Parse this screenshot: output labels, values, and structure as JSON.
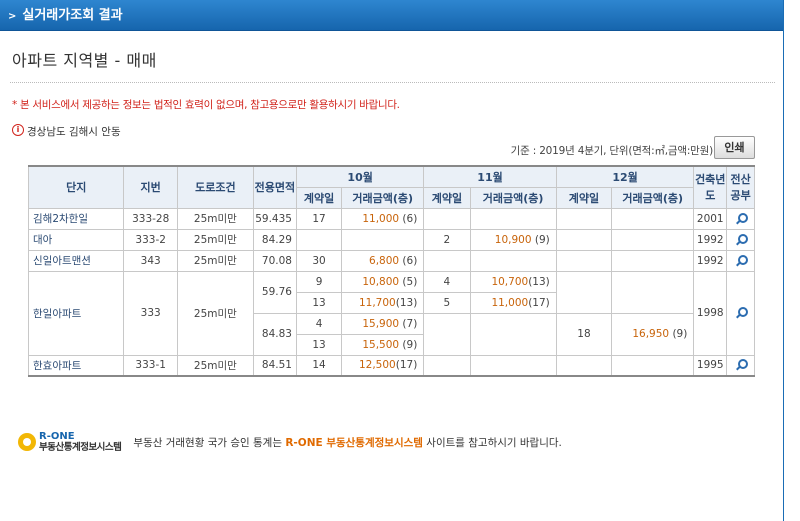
{
  "header": {
    "title": "실거래가조회 결과"
  },
  "page_title": "아파트 지역별 - 매매",
  "notice": "* 본 서비스에서 제공하는 정보는 법적인 효력이 없으며, 참고용으로만 활용하시기 바랍니다.",
  "location": "경상남도 김해시 안동",
  "basis": "기준 : 2019년 4분기, 단위(면적:㎡,금액:만원)",
  "print_label": "인쇄",
  "table": {
    "headers": {
      "complex": "단지",
      "lot": "지번",
      "road": "도로조건",
      "area": "전용면적",
      "month1": "10월",
      "month2": "11월",
      "month3": "12월",
      "contract_day": "계약일",
      "amount": "거래금액(층)",
      "built_year": "건축년도",
      "cadastral": "전산공부"
    },
    "rows": [
      {
        "name": "김해2차한일",
        "lot": "333-28",
        "road": "25m미만",
        "area": "59.435",
        "m10_day": "17",
        "m10_amt": "11,000",
        "m10_floor": "(6)",
        "m11_day": "",
        "m11_amt": "",
        "m11_floor": "",
        "m12_day": "",
        "m12_amt": "",
        "m12_floor": "",
        "year": "2001"
      },
      {
        "name": "대아",
        "lot": "333-2",
        "road": "25m미만",
        "area": "84.29",
        "m10_day": "",
        "m10_amt": "",
        "m10_floor": "",
        "m11_day": "2",
        "m11_amt": "10,900",
        "m11_floor": "(9)",
        "m12_day": "",
        "m12_amt": "",
        "m12_floor": "",
        "year": "1992"
      },
      {
        "name": "신일아트맨션",
        "lot": "343",
        "road": "25m미만",
        "area": "70.08",
        "m10_day": "30",
        "m10_amt": "6,800",
        "m10_floor": "(6)",
        "m11_day": "",
        "m11_amt": "",
        "m11_floor": "",
        "m12_day": "",
        "m12_amt": "",
        "m12_floor": "",
        "year": "1992"
      }
    ],
    "hanil": {
      "name": "한일아파트",
      "lot": "333",
      "road": "25m미만",
      "year": "1998",
      "area_a": "59.76",
      "area_b": "84.83",
      "a1": {
        "m10_day": "9",
        "m10_amt": "10,800",
        "m10_floor": "(5)",
        "m11_day": "4",
        "m11_amt": "10,700",
        "m11_floor": "(13)"
      },
      "a2": {
        "m10_day": "13",
        "m10_amt": "11,700",
        "m10_floor": "(13)",
        "m11_day": "5",
        "m11_amt": "11,000",
        "m11_floor": "(17)"
      },
      "b1": {
        "m10_day": "4",
        "m10_amt": "15,900",
        "m10_floor": "(7)"
      },
      "b2": {
        "m10_day": "13",
        "m10_amt": "15,500",
        "m10_floor": "(9)"
      },
      "b_m12": {
        "day": "18",
        "amt": "16,950",
        "floor": "(9)"
      }
    },
    "hanhyo": {
      "name": "한효아파트",
      "lot": "333-1",
      "road": "25m미만",
      "area": "84.51",
      "m10_day": "14",
      "m10_amt": "12,500",
      "m10_floor": "(17)",
      "year": "1995"
    }
  },
  "footer": {
    "logo_brand": "R-ONE",
    "logo_sub": "부동산통계정보시스템",
    "text_before": "부동산 거래현황 국가 승인 통계는",
    "highlight": "R-ONE 부동산통계정보시스템",
    "text_after": "사이트를 참고하시기 바랍니다."
  }
}
